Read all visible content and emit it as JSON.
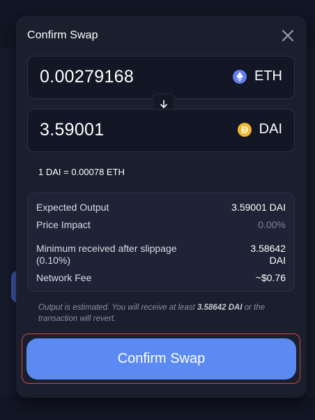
{
  "modal": {
    "title": "Confirm Swap"
  },
  "from_token": {
    "amount": "0.00279168",
    "symbol": "ETH",
    "icon": "ethereum-icon",
    "color": "#627eea"
  },
  "to_token": {
    "amount": "3.59001",
    "symbol": "DAI",
    "icon": "dai-icon",
    "color": "#f4b731"
  },
  "rate": "1 DAI = 0.00078 ETH",
  "details": {
    "expected_output": {
      "label": "Expected Output",
      "value": "3.59001 DAI"
    },
    "price_impact": {
      "label": "Price Impact",
      "value": "0.00%"
    },
    "minimum_received": {
      "label": "Minimum received after slippage (0.10%)",
      "value": "3.58642 DAI"
    },
    "network_fee": {
      "label": "Network Fee",
      "value": "~$0.76"
    }
  },
  "note": {
    "prefix": "Output is estimated. You will receive at least ",
    "amount": "3.58642 DAI",
    "suffix": " or the transaction will revert."
  },
  "confirm_button": {
    "label": "Confirm Swap",
    "color": "#5b8af3",
    "outline_color": "#d6453c"
  }
}
